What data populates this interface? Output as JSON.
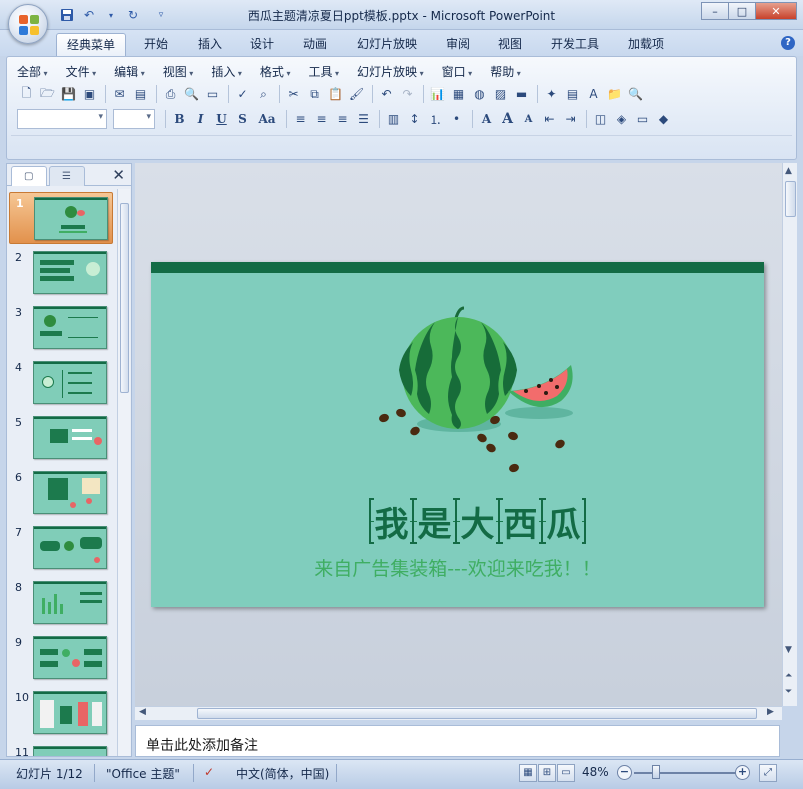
{
  "window": {
    "title": "西瓜主题清凉夏日ppt模板.pptx - Microsoft PowerPoint",
    "controls": [
      "–",
      "□",
      "✕"
    ]
  },
  "tabs": [
    {
      "label": "经典菜单",
      "active": true
    },
    {
      "label": "开始"
    },
    {
      "label": "插入"
    },
    {
      "label": "设计"
    },
    {
      "label": "动画"
    },
    {
      "label": "幻灯片放映"
    },
    {
      "label": "审阅"
    },
    {
      "label": "视图"
    },
    {
      "label": "开发工具"
    },
    {
      "label": "加载项"
    }
  ],
  "menu": [
    "全部",
    "文件",
    "编辑",
    "视图",
    "插入",
    "格式",
    "工具",
    "幻灯片放映",
    "窗口",
    "帮助"
  ],
  "toolbar": {
    "bold": "B",
    "italic": "I",
    "underline": "U",
    "strike": "S",
    "case": "Aa",
    "font_a": "A",
    "font_grow": "A",
    "font_shrink": "A"
  },
  "thumbnails": [
    "1",
    "2",
    "3",
    "4",
    "5",
    "6",
    "7",
    "8",
    "9",
    "10",
    "11"
  ],
  "slide": {
    "title_chars": [
      "我",
      "是",
      "大",
      "西",
      "瓜"
    ],
    "subtitle": "来自广告集装箱---欢迎来吃我！！"
  },
  "notes": {
    "placeholder": "单击此处添加备注"
  },
  "status": {
    "slide_counter": "幻灯片 1/12",
    "theme": "\"Office 主题\"",
    "language": "中文(简体，中国)",
    "zoom": "48%"
  },
  "colors": {
    "slide_bg": "#80cdbd",
    "slide_bar": "#136b45",
    "subtitle": "#3fae63",
    "selected_thumb": "#e2914c"
  }
}
